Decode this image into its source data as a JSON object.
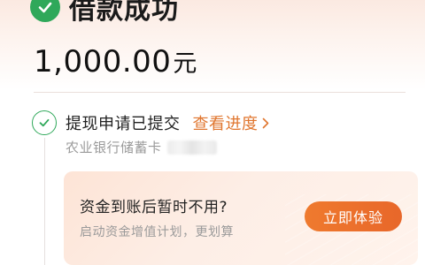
{
  "status": {
    "title": "借款成功",
    "icon": "check-icon",
    "color": "#2fa85a"
  },
  "amount": {
    "value": "1,000.00",
    "unit": "元"
  },
  "step": {
    "title": "提现申请已提交",
    "link_label": "查看进度",
    "link_color": "#e0762f",
    "bank_name": "农业银行储蓄卡"
  },
  "promo": {
    "title": "资金到账后暂时不用?",
    "subtitle": "启动资金增值计划，更划算",
    "button_label": "立即体验",
    "button_color": "#ec712d"
  }
}
